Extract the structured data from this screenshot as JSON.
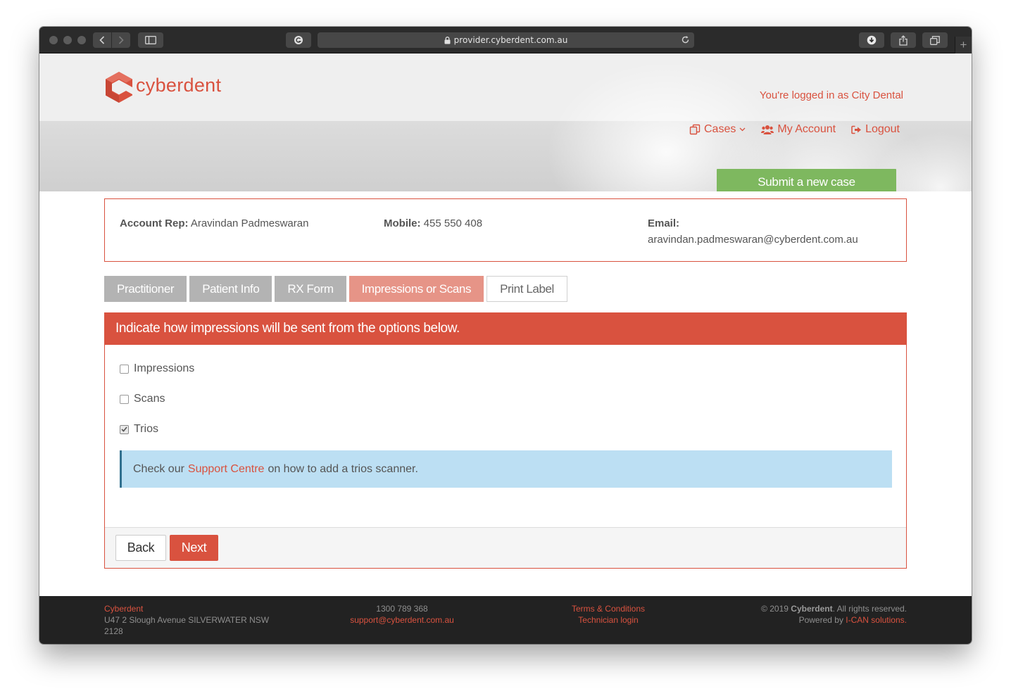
{
  "browser": {
    "url": "provider.cyberdent.com.au"
  },
  "header": {
    "logo_text": "cyberdent",
    "login_status": "You're logged in as City Dental",
    "nav": {
      "cases": "Cases",
      "my_account": "My Account",
      "logout": "Logout"
    },
    "submit_label": "Submit a new case"
  },
  "account_rep": {
    "rep_label": "Account Rep:",
    "rep_value": "Aravindan Padmeswaran",
    "mobile_label": "Mobile:",
    "mobile_value": "455 550 408",
    "email_label": "Email:",
    "email_value": "aravindan.padmeswaran@cyberdent.com.au"
  },
  "tabs": [
    {
      "label": "Practitioner"
    },
    {
      "label": "Patient Info"
    },
    {
      "label": "RX Form"
    },
    {
      "label": "Impressions or Scans"
    },
    {
      "label": "Print Label"
    }
  ],
  "panel": {
    "heading": "Indicate how impressions will be sent from the options below.",
    "options": [
      {
        "label": "Impressions",
        "checked": false
      },
      {
        "label": "Scans",
        "checked": false
      },
      {
        "label": "Trios",
        "checked": true
      }
    ],
    "info": {
      "prefix": "Check our",
      "link": "Support Centre",
      "suffix": "on how to add a trios scanner."
    },
    "back_label": "Back",
    "next_label": "Next"
  },
  "footer": {
    "company": "Cyberdent",
    "address": "U47 2 Slough Avenue SILVERWATER NSW 2128",
    "phone": "1300 789 368",
    "support_email": "support@cyberdent.com.au",
    "terms": "Terms & Conditions",
    "tech_login": "Technician login",
    "copyright_prefix": "© 2019",
    "copyright_brand": "Cyberdent",
    "copyright_suffix": ". All rights reserved.",
    "powered_prefix": "Powered by",
    "powered_link": "I-CAN solutions."
  },
  "colors": {
    "brand": "#d9523f",
    "submit": "#7eb85f",
    "tab_inactive": "#b3b3b3",
    "tab_active": "#e69487",
    "info_bg": "#bcdff3"
  }
}
